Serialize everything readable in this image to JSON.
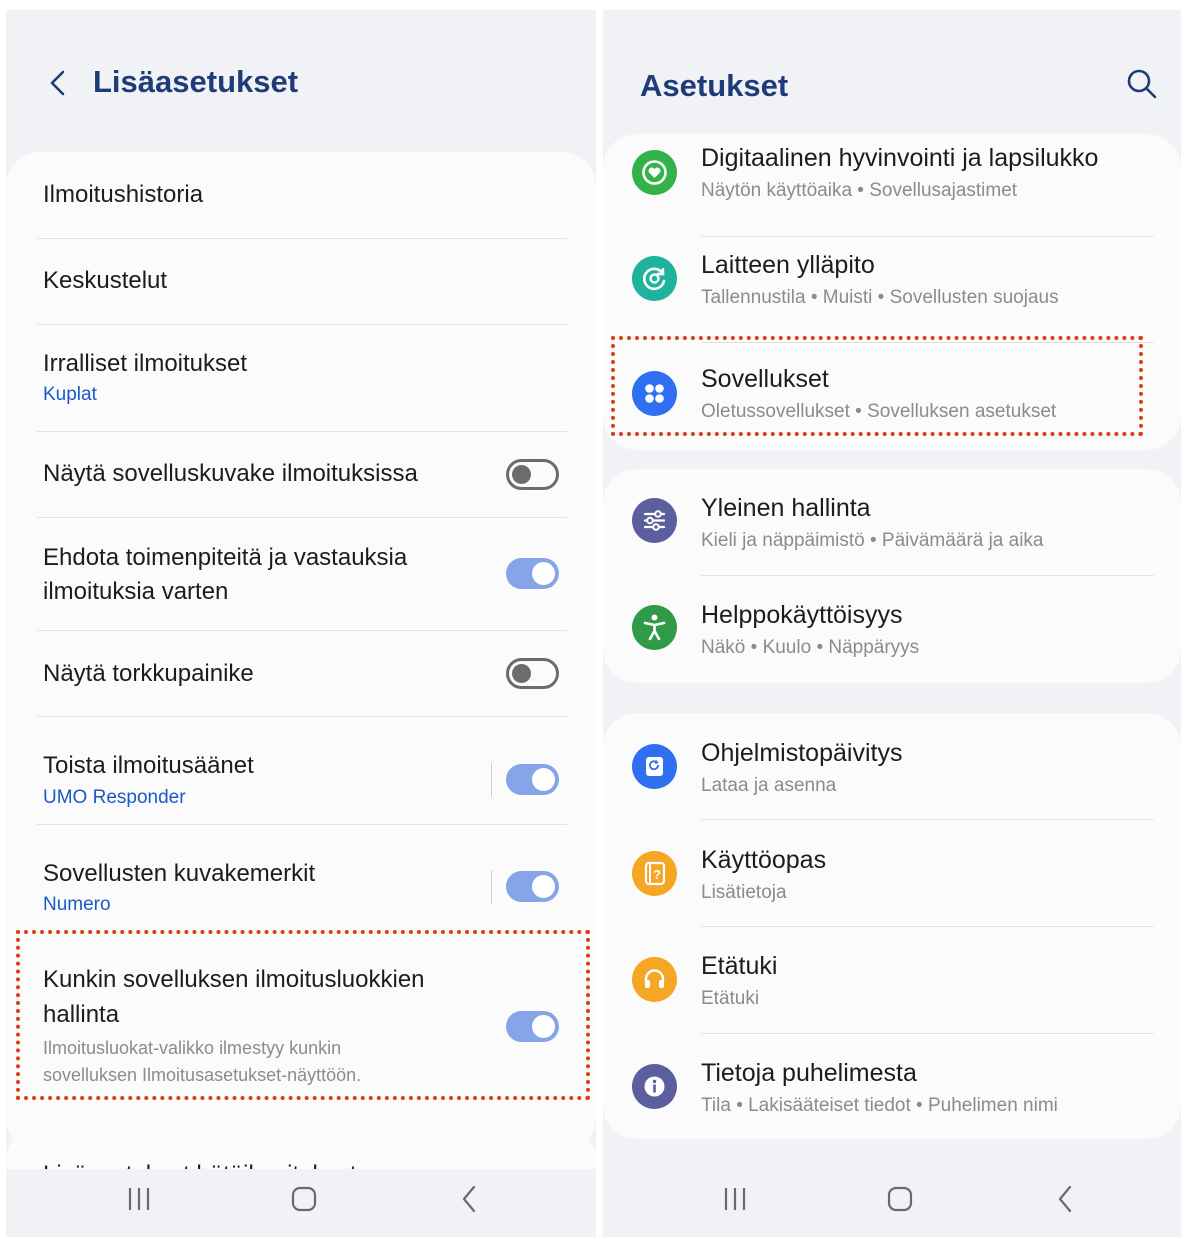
{
  "left_screen": {
    "title": "Lisäasetukset",
    "rows": [
      {
        "title": "Ilmoitushistoria"
      },
      {
        "title": "Keskustelut"
      },
      {
        "title": "Irralliset ilmoitukset",
        "subtitle": "Kuplat"
      },
      {
        "title": "Näytä sovelluskuvake ilmoituksissa",
        "toggle": "off"
      },
      {
        "title": "Ehdota toimenpiteitä ja vastauksia",
        "title2": "ilmoituksia varten",
        "toggle": "on"
      },
      {
        "title": "Näytä torkkupainike",
        "toggle": "off"
      },
      {
        "title": "Toista ilmoitusäänet",
        "subtitle": "UMO Responder",
        "toggle": "on"
      },
      {
        "title": "Sovellusten kuvakemerkit",
        "subtitle": "Numero",
        "toggle": "on"
      },
      {
        "title": "Kunkin sovelluksen ilmoitusluokkien",
        "title2": "hallinta",
        "desc": "Ilmoitusluokat-valikko ilmestyy kunkin",
        "desc2": "sovelluksen Ilmoitusasetukset-näyttöön.",
        "toggle": "on"
      }
    ],
    "partial_row": "Lisäasetukset hätäilmoitukset"
  },
  "right_screen": {
    "title": "Asetukset",
    "items": [
      {
        "title": "Digitaalinen hyvinvointi ja lapsilukko",
        "subtitle": "Näytön käyttöaika  •  Sovellusajastimet",
        "icon": "heart-circle-icon",
        "color": "#33b249"
      },
      {
        "title": "Laitteen ylläpito",
        "subtitle": "Tallennustila  •  Muisti  •  Sovellusten suojaus",
        "icon": "device-care-icon",
        "color": "#1eb39c"
      },
      {
        "title": "Sovellukset",
        "subtitle": "Oletussovellukset  •  Sovelluksen asetukset",
        "icon": "apps-grid-icon",
        "color": "#2f6ff1"
      },
      {
        "title": "Yleinen hallinta",
        "subtitle": "Kieli ja näppäimistö  •  Päivämäärä ja aika",
        "icon": "sliders-icon",
        "color": "#5b5f9e"
      },
      {
        "title": "Helppokäyttöisyys",
        "subtitle": "Näkö  •  Kuulo  •  Näppäryys",
        "icon": "accessibility-icon",
        "color": "#2f9a48"
      },
      {
        "title": "Ohjelmistopäivitys",
        "subtitle": "Lataa ja asenna",
        "icon": "software-update-icon",
        "color": "#2f6ff1"
      },
      {
        "title": "Käyttöopas",
        "subtitle": "Lisätietoja",
        "icon": "user-manual-icon",
        "color": "#f5a623"
      },
      {
        "title": "Etätuki",
        "subtitle": "Etätuki",
        "icon": "headset-icon",
        "color": "#f5a623"
      },
      {
        "title": "Tietoja puhelimesta",
        "subtitle": "Tila  •  Lakisääteiset tiedot  •  Puhelimen nimi",
        "icon": "info-icon",
        "color": "#5b5f9e"
      }
    ]
  },
  "colors": {
    "accent_title": "#1d3c78",
    "link_blue": "#1a59c8",
    "toggle_on": "#86a4e8",
    "highlight": "#e23b1c"
  }
}
